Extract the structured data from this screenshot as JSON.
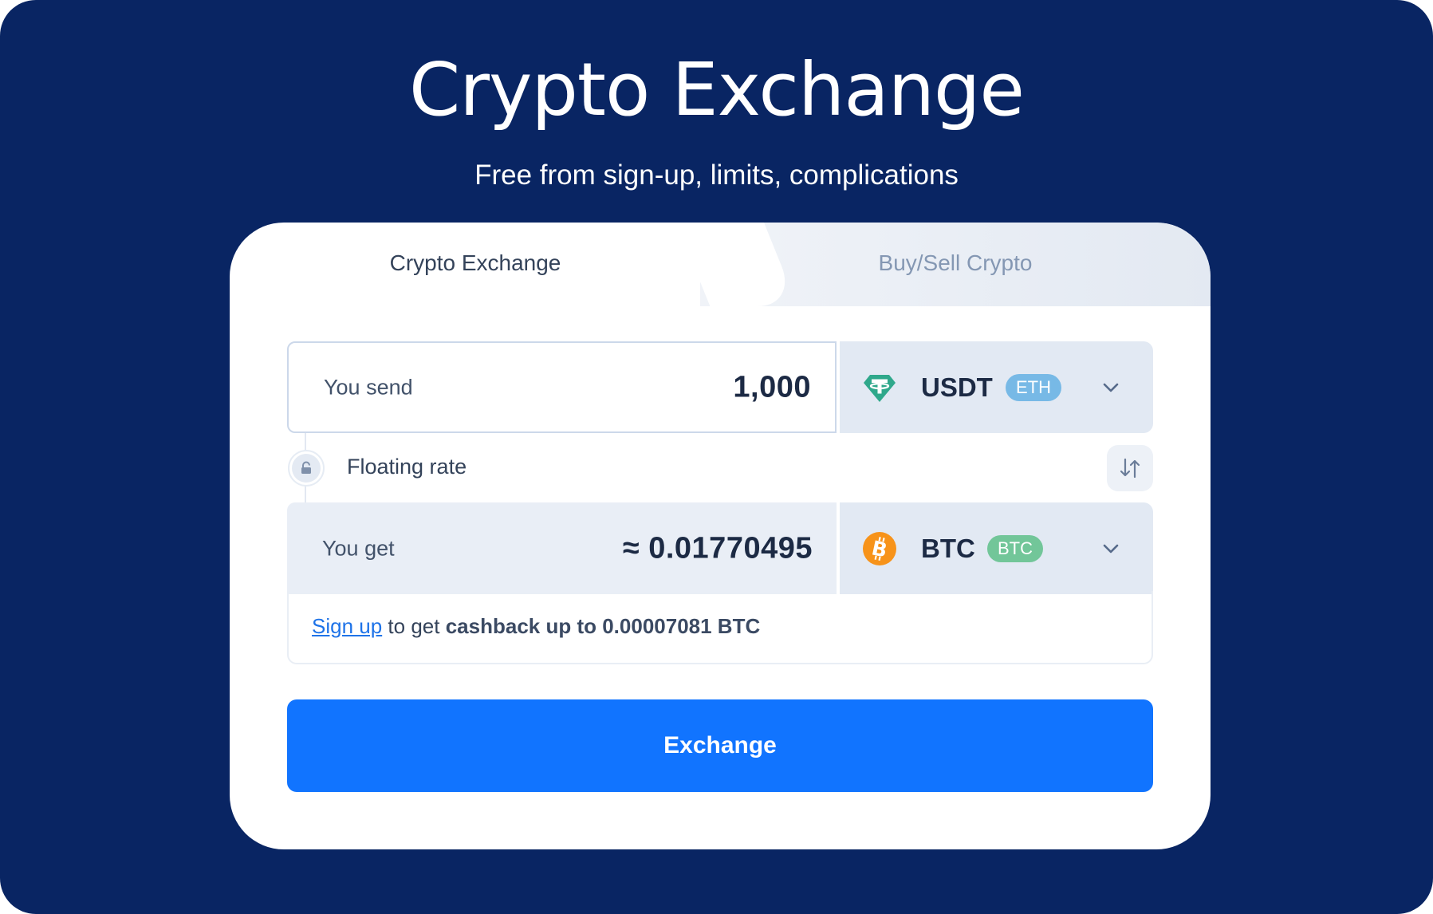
{
  "hero": {
    "title": "Crypto Exchange",
    "subtitle": "Free from sign-up, limits, complications"
  },
  "tabs": [
    {
      "label": "Crypto Exchange",
      "active": true
    },
    {
      "label": "Buy/Sell Crypto",
      "active": false
    }
  ],
  "send": {
    "label": "You send",
    "amount": "1,000",
    "currency": {
      "ticker": "USDT",
      "network": "ETH",
      "icon": "tether-icon"
    }
  },
  "rate": {
    "label": "Floating rate",
    "icon": "lock-icon"
  },
  "get": {
    "label": "You get",
    "amount": "≈ 0.01770495",
    "currency": {
      "ticker": "BTC",
      "network": "BTC",
      "icon": "bitcoin-icon"
    }
  },
  "cashback": {
    "link": "Sign up",
    "text": "to get",
    "strong": "cashback up to 0.00007081 BTC"
  },
  "action": {
    "label": "Exchange"
  },
  "colors": {
    "background": "#092563",
    "accent": "#1174ff",
    "tether": "#2fa88b",
    "bitcoin": "#f7931a",
    "eth_badge": "#77b9e6",
    "btc_badge": "#72c699"
  }
}
